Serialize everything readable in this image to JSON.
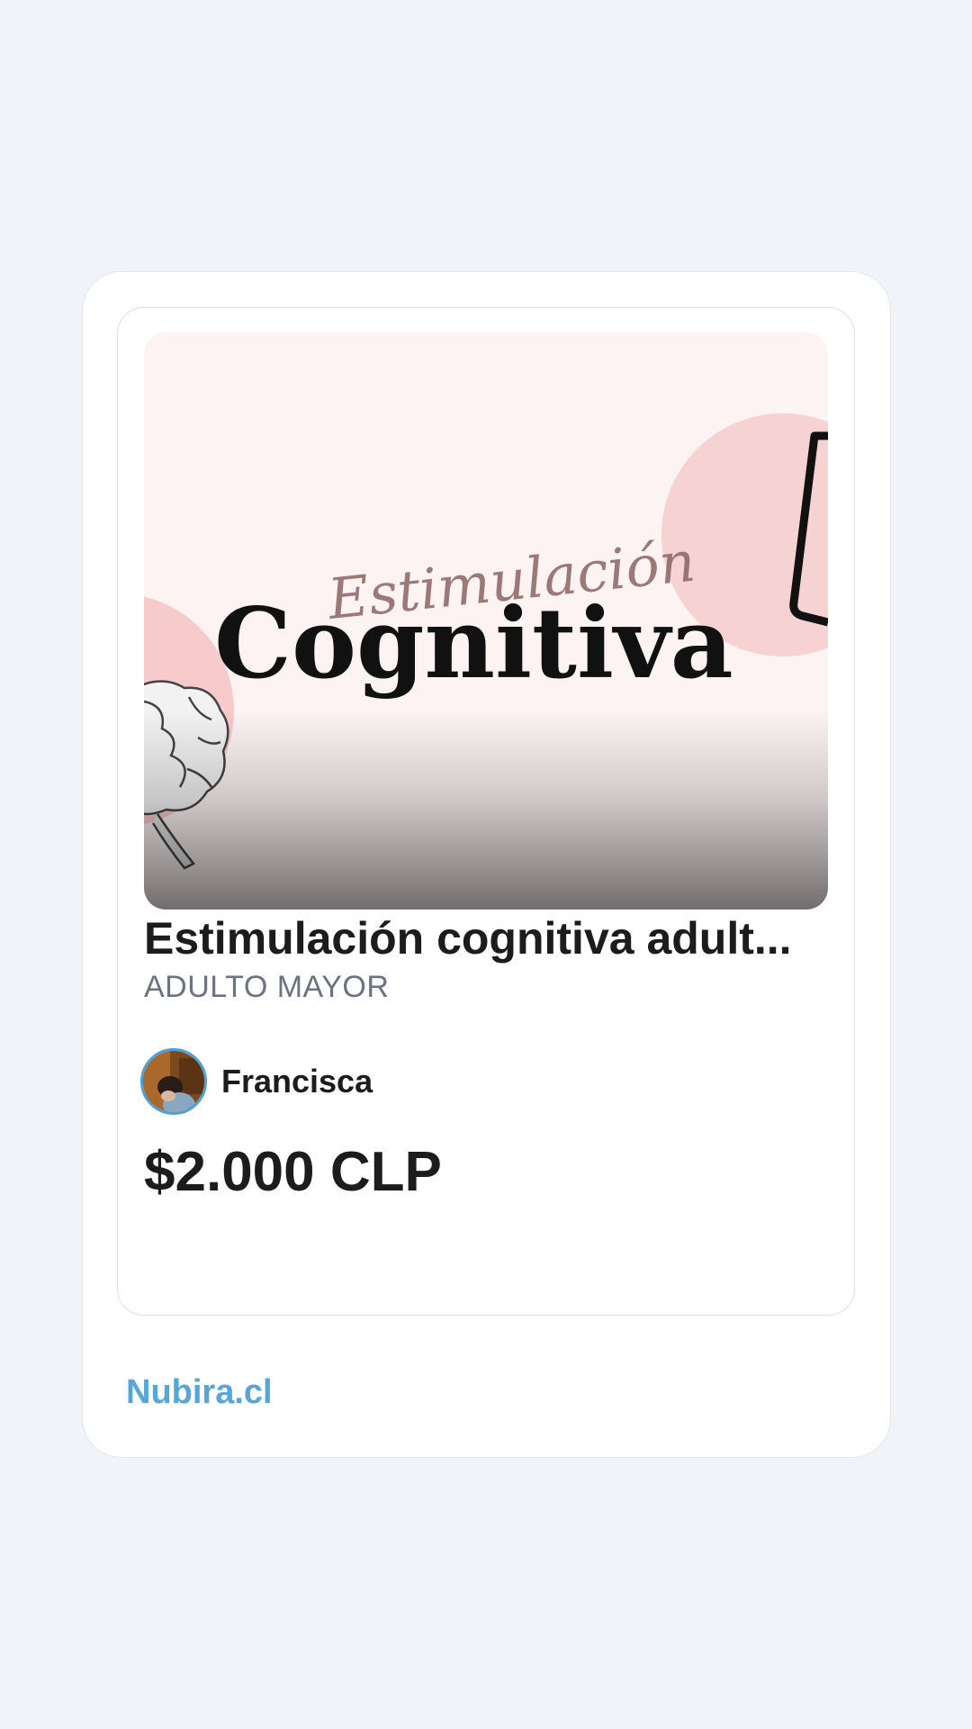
{
  "product": {
    "image": {
      "script_word": "Estimulación",
      "main_word": "Cognitiva"
    },
    "title": "Estimulación cognitiva adult...",
    "category": "ADULTO MAYOR",
    "seller": {
      "name": "Francisca"
    },
    "price": "$2.000 CLP"
  },
  "footer": {
    "brand": "Nubira.cl"
  },
  "colors": {
    "page_background": "#f0f4f8",
    "brand": "#56a6d6",
    "text_primary": "#1c1c1e",
    "text_secondary": "#6b7380",
    "avatar_ring": "#4ea0d6"
  }
}
